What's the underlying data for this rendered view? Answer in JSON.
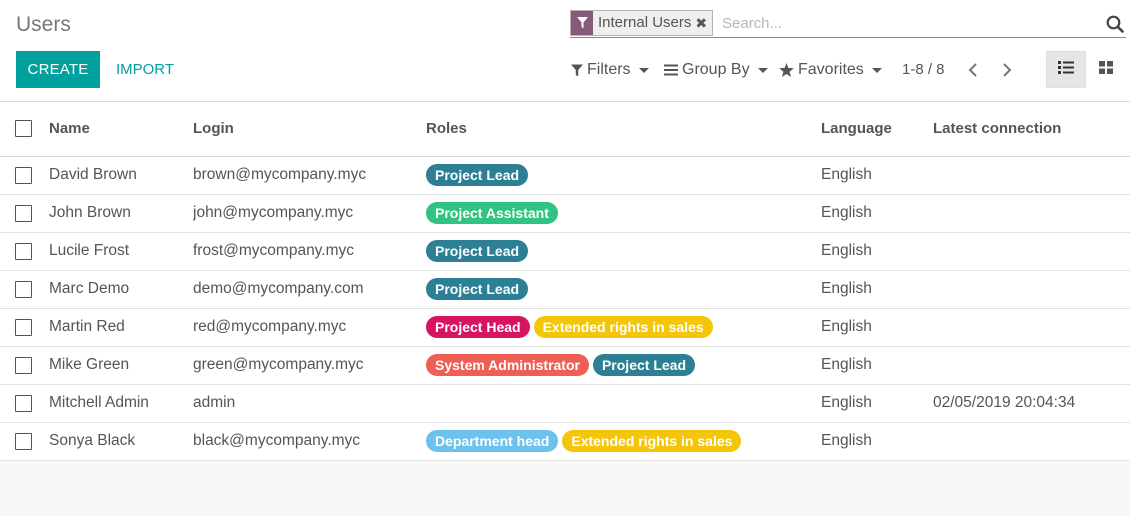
{
  "page": {
    "title": "Users"
  },
  "search": {
    "facet_value": "Internal Users",
    "placeholder": "Search...",
    "facet_icon": "filter-icon",
    "facet_color": "#875a7b"
  },
  "buttons": {
    "create": "CREATE",
    "import": "IMPORT"
  },
  "toolbar": {
    "filters": "Filters",
    "group_by": "Group By",
    "favorites": "Favorites"
  },
  "pager": {
    "value": "1-8 / 8"
  },
  "views": {
    "active": "list"
  },
  "colors": {
    "accent": "#00a09d",
    "facet": "#875a7b"
  },
  "columns": [
    "Name",
    "Login",
    "Roles",
    "Language",
    "Latest connection"
  ],
  "rows": [
    {
      "name": "David Brown",
      "login": "brown@mycompany.myc",
      "roles": [
        {
          "label": "Project Lead",
          "color": "#2c7f95"
        }
      ],
      "language": "English",
      "latest": ""
    },
    {
      "name": "John Brown",
      "login": "john@mycompany.myc",
      "roles": [
        {
          "label": "Project Assistant",
          "color": "#30c381"
        }
      ],
      "language": "English",
      "latest": ""
    },
    {
      "name": "Lucile Frost",
      "login": "frost@mycompany.myc",
      "roles": [
        {
          "label": "Project Lead",
          "color": "#2c7f95"
        }
      ],
      "language": "English",
      "latest": ""
    },
    {
      "name": "Marc Demo",
      "login": "demo@mycompany.com",
      "roles": [
        {
          "label": "Project Lead",
          "color": "#2c7f95"
        }
      ],
      "language": "English",
      "latest": ""
    },
    {
      "name": "Martin Red",
      "login": "red@mycompany.myc",
      "roles": [
        {
          "label": "Project Head",
          "color": "#d6145f"
        },
        {
          "label": "Extended rights in sales",
          "color": "#f4c609"
        }
      ],
      "language": "English",
      "latest": ""
    },
    {
      "name": "Mike Green",
      "login": "green@mycompany.myc",
      "roles": [
        {
          "label": "System Administrator",
          "color": "#ee6055"
        },
        {
          "label": "Project Lead",
          "color": "#2c7f95"
        }
      ],
      "language": "English",
      "latest": ""
    },
    {
      "name": "Mitchell Admin",
      "login": "admin",
      "roles": [],
      "language": "English",
      "latest": "02/05/2019 20:04:34"
    },
    {
      "name": "Sonya Black",
      "login": "black@mycompany.myc",
      "roles": [
        {
          "label": "Department head",
          "color": "#6cc1ed"
        },
        {
          "label": "Extended rights in sales",
          "color": "#f4c609"
        }
      ],
      "language": "English",
      "latest": ""
    }
  ]
}
